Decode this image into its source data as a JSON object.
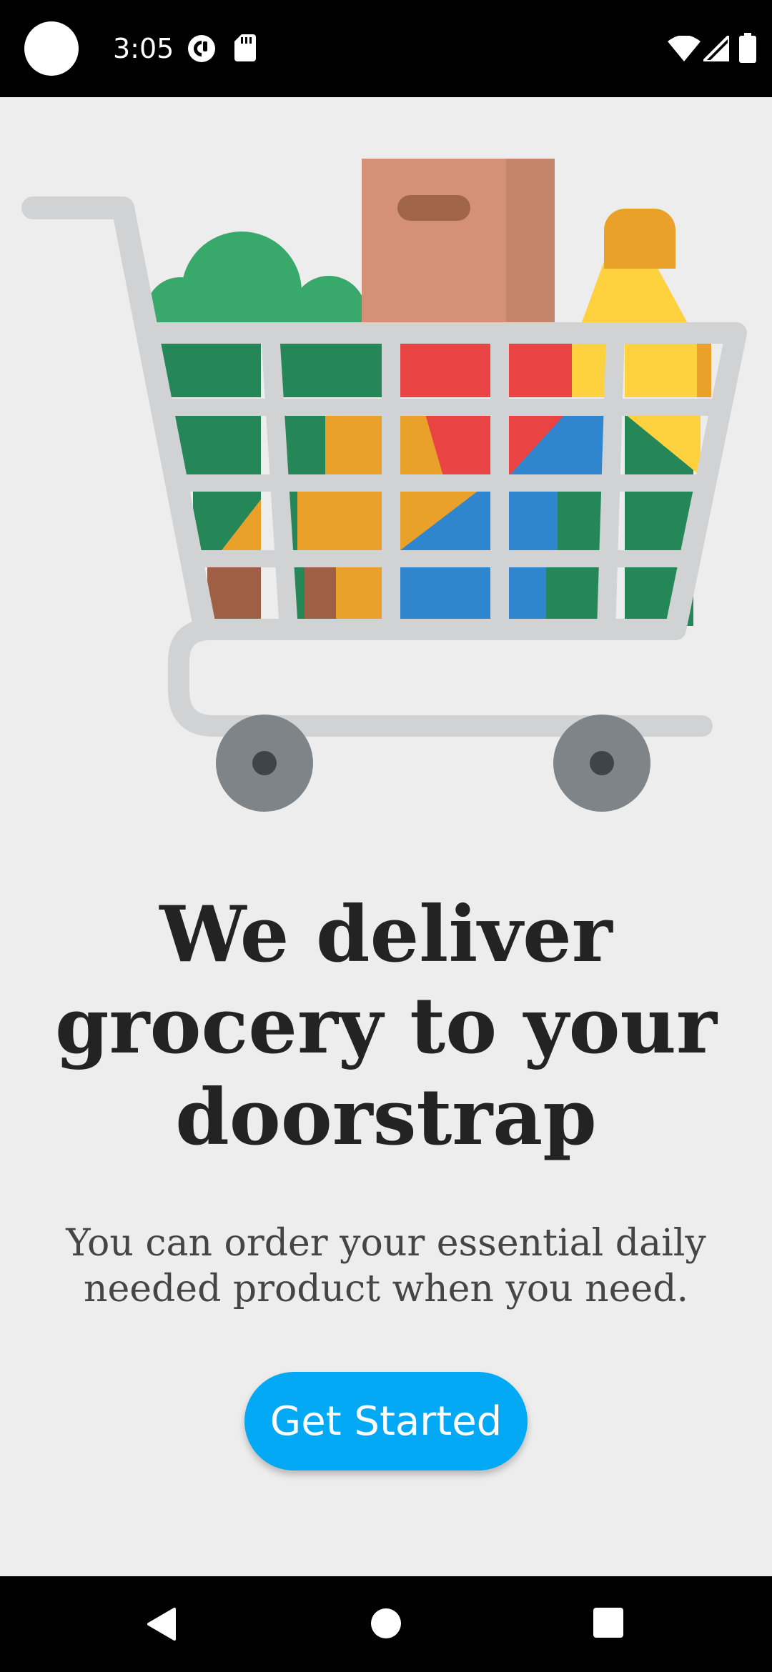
{
  "status_bar": {
    "time": "3:05",
    "icons": [
      "camera-cutout",
      "pocket-casts-icon",
      "sd-card-icon",
      "wifi-icon",
      "signal-icon",
      "battery-icon"
    ]
  },
  "onboarding": {
    "illustration": "shopping-cart-with-groceries",
    "headline": "We deliver grocery to your doorstrap",
    "subtitle": "You can order your essential daily needed product when you need.",
    "cta_label": "Get Started"
  },
  "nav_bar": {
    "buttons": [
      "back-icon",
      "home-icon",
      "recents-icon"
    ]
  },
  "colors": {
    "background": "#ededed",
    "accent": "#03a9f4",
    "headline": "#232323",
    "subtitle": "#454545"
  }
}
